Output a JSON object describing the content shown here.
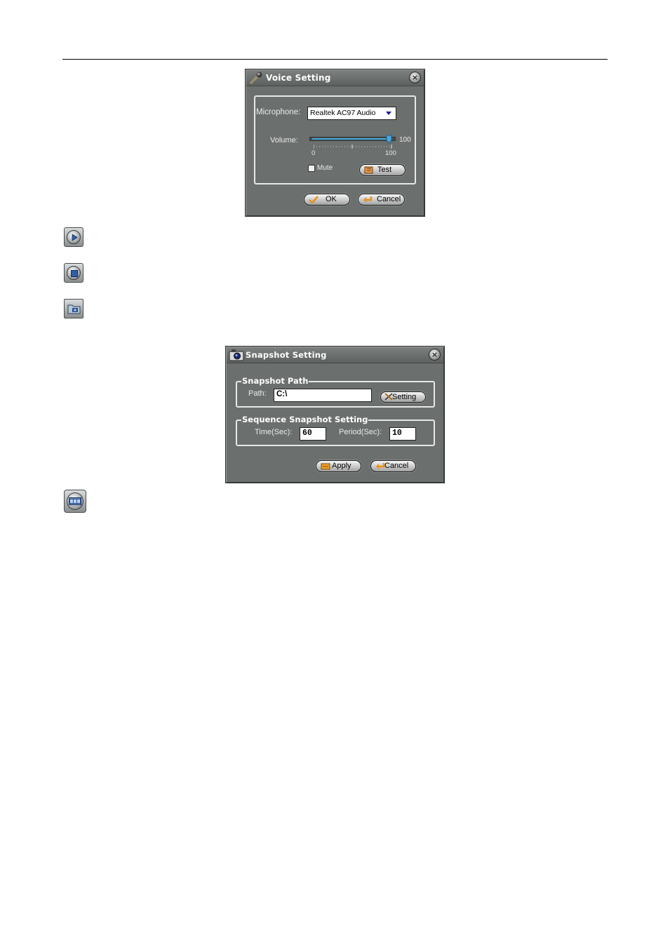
{
  "voice_dialog": {
    "title": "Voice Setting",
    "close_glyph": "×",
    "microphone_label": "Microphone:",
    "microphone_value": "Realtek AC97 Audio",
    "volume_label": "Volume:",
    "volume_value": "100",
    "volume_level": 100,
    "scale_min": "0",
    "scale_max": "100",
    "mute_label": "Mute",
    "mute_checked": false,
    "test_button": "Test",
    "ok_button": "OK",
    "cancel_button": "Cancel"
  },
  "snapshot_dialog": {
    "title": "Snapshot Setting",
    "close_glyph": "×",
    "path_group": "Snapshot Path",
    "path_label": "Path:",
    "path_value": "C:\\",
    "setting_button": "Setting",
    "sequence_group": "Sequence Snapshot Setting",
    "time_label": "Time(Sec):",
    "time_value": "60",
    "period_label": "Period(Sec):",
    "period_value": "10",
    "apply_button": "Apply",
    "cancel_button": "Cancel"
  },
  "side_icons": [
    "play-icon",
    "stop-icon",
    "snapshot-folder-icon",
    "film-strip-icon"
  ]
}
